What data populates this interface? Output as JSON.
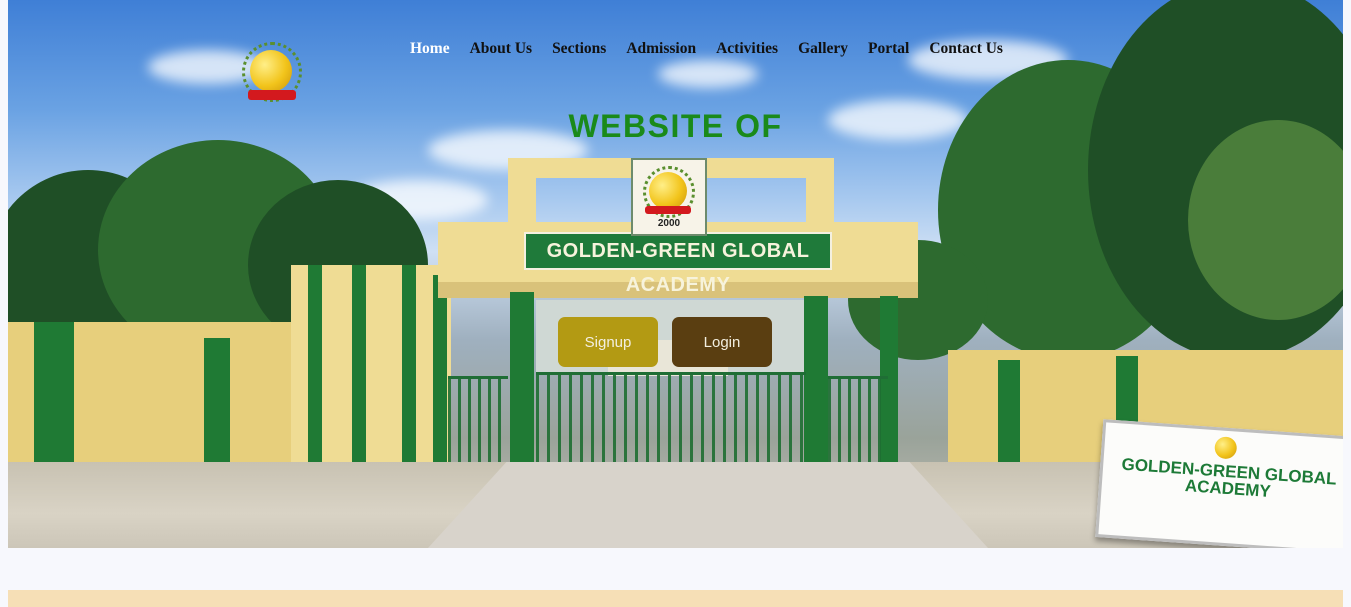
{
  "nav": {
    "items": [
      {
        "label": "Home",
        "active": true
      },
      {
        "label": "About Us"
      },
      {
        "label": "Sections"
      },
      {
        "label": "Admission"
      },
      {
        "label": "Activities"
      },
      {
        "label": "Gallery"
      },
      {
        "label": "Portal"
      },
      {
        "label": "Contact Us"
      }
    ]
  },
  "hero": {
    "headline": "WEBSITE OF",
    "gate_sign": "GOLDEN-GREEN GLOBAL ACADEMY",
    "crest_year": "2000",
    "board_title": "GOLDEN-GREEN GLOBAL ACADEMY"
  },
  "actions": {
    "signup_label": "Signup",
    "login_label": "Login"
  },
  "colors": {
    "headline": "#1a8a1a",
    "signup_button": "#b39a13",
    "login_button": "#5a3e11",
    "band": "#f6dfb6",
    "page_bg": "#f7f8fd"
  },
  "icons": {
    "logo": "gold-medal-laurel-logo"
  }
}
